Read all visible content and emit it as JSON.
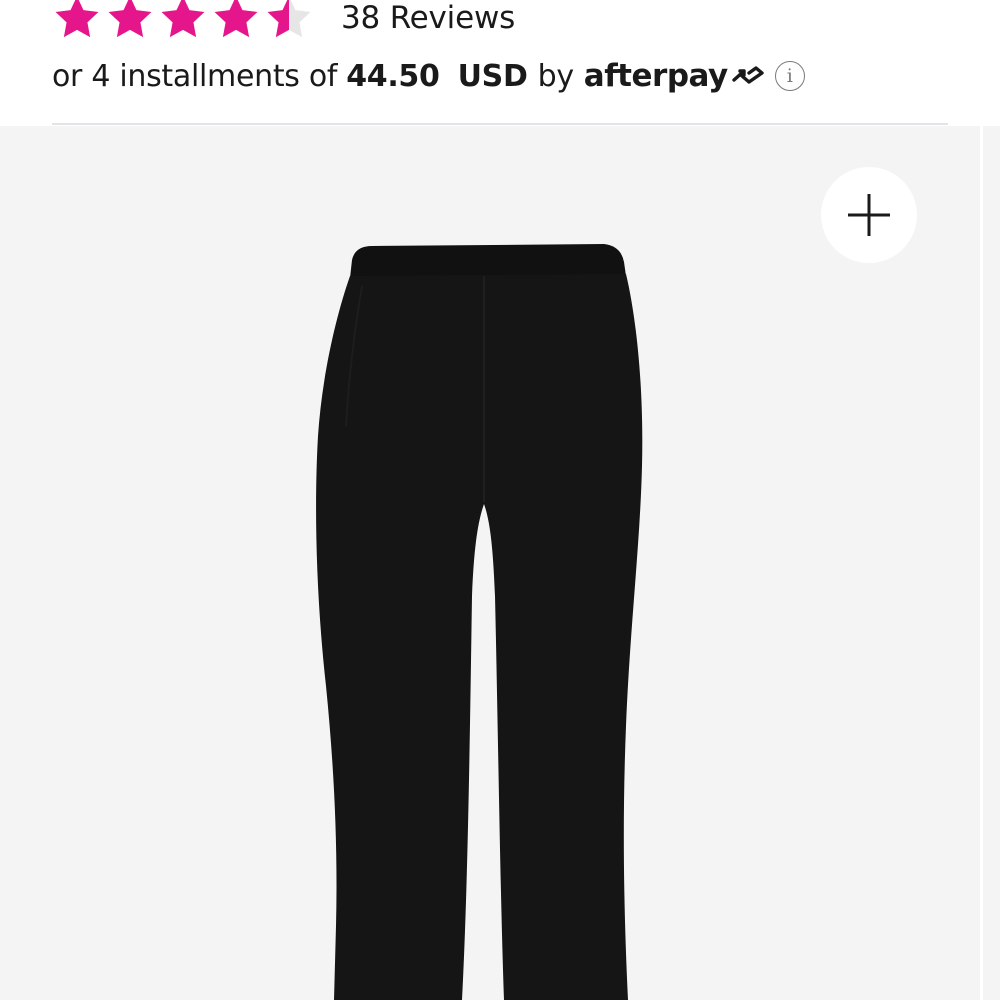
{
  "rating": {
    "value": 4.5,
    "max": 5,
    "star_color": "#e5158b",
    "empty_star_color": "#e6e6e6",
    "reviews_label": "38 Reviews"
  },
  "installments": {
    "prefix": "or 4 installments of",
    "amount": "44.50",
    "currency": "USD",
    "by": "by",
    "provider": "afterpay",
    "provider_icon": "afterpay-arrows-icon",
    "info_icon": "info-icon",
    "info_glyph": "i"
  },
  "gallery": {
    "background": "#f4f4f4",
    "zoom_icon": "plus-icon",
    "image": "black-flare-pants"
  }
}
